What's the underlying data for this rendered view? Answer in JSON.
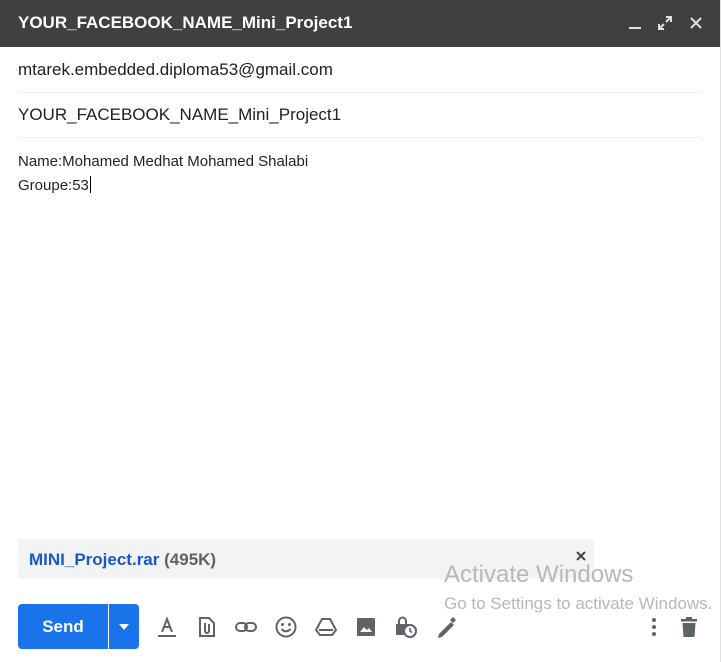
{
  "window": {
    "title": "YOUR_FACEBOOK_NAME_Mini_Project1",
    "minimize_icon": "minimize-icon",
    "fullscreen_icon": "expand-icon",
    "close_icon": "close-icon"
  },
  "recipients": {
    "to": "mtarek.embedded.diploma53@gmail.com"
  },
  "subject": {
    "value": "YOUR_FACEBOOK_NAME_Mini_Project1"
  },
  "message": {
    "line1": "Name:Mohamed Medhat Mohamed Shalabi",
    "line2": "Groupe:53"
  },
  "attachment": {
    "name": "MINI_Project.rar",
    "size": "(495K)"
  },
  "watermark": {
    "line1": "Activate Windows",
    "line2": "Go to Settings to activate Windows."
  },
  "toolbar": {
    "send_label": "Send",
    "icons": [
      "formatting-icon",
      "attach-file-icon",
      "insert-link-icon",
      "emoji-icon",
      "drive-icon",
      "insert-photo-icon",
      "confidential-mode-icon",
      "signature-icon",
      "more-options-icon",
      "discard-icon"
    ]
  },
  "colors": {
    "titlebar": "#404040",
    "send_button": "#1a73e8",
    "attachment_link": "#1a57c9"
  }
}
